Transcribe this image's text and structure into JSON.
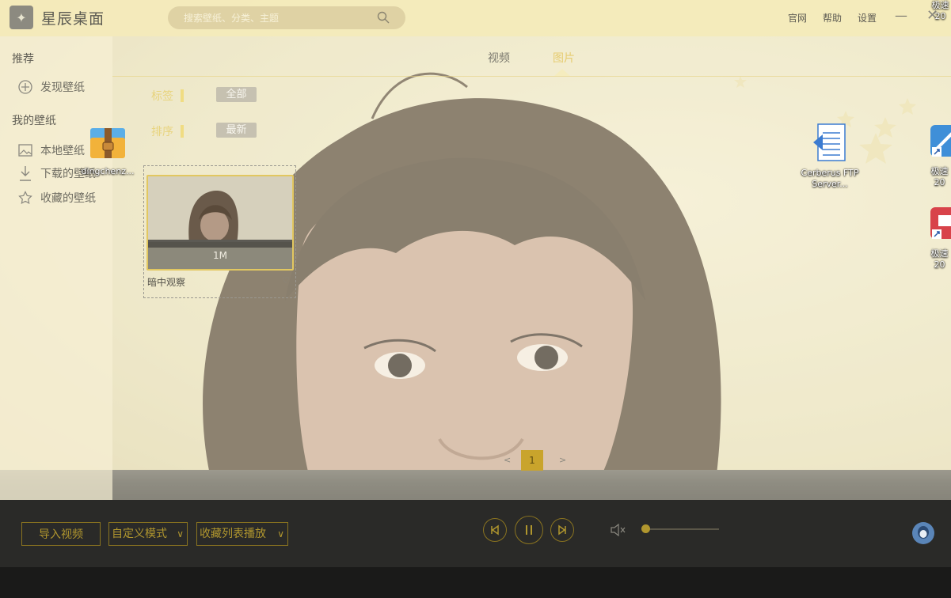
{
  "app": {
    "title": "星辰桌面",
    "logo_icon": "star-figure-icon"
  },
  "search": {
    "placeholder": "搜索壁纸、分类、主题"
  },
  "top_links": [
    "官网",
    "帮助",
    "设置"
  ],
  "sidebar": {
    "recommend_heading": "推荐",
    "discover_label": "发现壁纸",
    "my_heading": "我的壁纸",
    "items": [
      {
        "label": "本地壁纸",
        "icon": "image-icon"
      },
      {
        "label": "下载的壁纸",
        "icon": "download-icon"
      },
      {
        "label": "收藏的壁纸",
        "icon": "star-icon"
      }
    ]
  },
  "tabs": [
    {
      "label": "视频",
      "active": false
    },
    {
      "label": "图片",
      "active": true
    }
  ],
  "filters": {
    "tag_label": "标签",
    "tag_value": "全部",
    "sort_label": "排序",
    "sort_value": "最新"
  },
  "wallpapers": [
    {
      "name": "暗中观察",
      "size": "1M"
    }
  ],
  "pagination": {
    "prev": "<",
    "current": "1",
    "next": ">"
  },
  "desktop_icons": [
    {
      "label": "dingchenz...",
      "icon": "archive-folder-icon"
    },
    {
      "label": "Cerberus FTP Server...",
      "icon": "document-icon"
    },
    {
      "label": "极速 20",
      "icon": "shortcut-blue-icon"
    },
    {
      "label": "极速 20",
      "icon": "shortcut-red-icon"
    },
    {
      "label": "极速 20",
      "icon": "shortcut-top-icon"
    }
  ],
  "player": {
    "import_label": "导入视频",
    "mode_label": "自定义模式",
    "playlist_label": "收藏列表播放",
    "volume": 0.0,
    "muted": true
  },
  "colors": {
    "accent_gold": "#b0962e",
    "titlebar": "#f4eaba",
    "player_bg": "#2a2a28",
    "active_tab": "#e6cc70"
  }
}
